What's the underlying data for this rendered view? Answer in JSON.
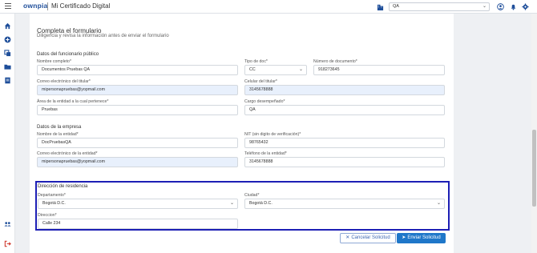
{
  "header": {
    "brand": "ownpia",
    "app_title": "Mi Certificado Digital",
    "company_value": "QA"
  },
  "form": {
    "title": "Completa el formulario",
    "subtitle": "Diligencia y revisa la información antes de enviar el formulario"
  },
  "funcionario": {
    "section_title": "Datos del funcionario público",
    "nombre_label": "Nombre completo*",
    "nombre_value": "Documentos Pruebas QA",
    "tipo_doc_label": "Tipo de doc*",
    "tipo_doc_value": "CC",
    "num_doc_label": "Número de documento*",
    "num_doc_value": "918273645",
    "correo_label": "Correo electrónico del titular*",
    "correo_value": "mipersonapruebas@yopmail.com",
    "celular_label": "Celular del titular*",
    "celular_value": "3145678888",
    "area_label": "Área de la entidad a la cual pertenece*",
    "area_value": "Pruebas",
    "cargo_label": "Cargo desempeñado*",
    "cargo_value": "QA"
  },
  "empresa": {
    "section_title": "Datos de la empresa",
    "nombre_label": "Nombre de la entidad*",
    "nombre_value": "DocPruebasQA",
    "nit_label": "NIT (sin digito de verificación)*",
    "nit_value": "98765432",
    "correo_label": "Correo electrónico de la entidad*",
    "correo_value": "mipersonapruebas@yopmail.com",
    "telefono_label": "Teléfono de la entidad*",
    "telefono_value": "3145678888"
  },
  "residencia": {
    "section_title": "Dirección de residencia",
    "departamento_label": "Departamento*",
    "departamento_value": "Bogotá D.C.",
    "ciudad_label": "Ciudad*",
    "ciudad_value": "Bogotá D.C.",
    "direccion_label": "Direccion*",
    "direccion_value": "Calle 234"
  },
  "actions": {
    "cancel_label": "Cancelar Solicitud",
    "send_label": "Enviar Solicitud"
  },
  "icons": {
    "menu": "hamburger-icon",
    "company": "building-icon",
    "user": "user-circle-icon",
    "bell": "bell-icon",
    "settings": "gear-icon",
    "home": "home-icon",
    "add": "plus-circle-icon",
    "copy": "copy-icon",
    "folder": "folder-icon",
    "document": "document-icon",
    "users": "users-icon",
    "logout": "logout-icon"
  },
  "colors": {
    "brand": "#1e4e9a",
    "highlight": "#1d1fb5",
    "primary_button": "#1f77c9",
    "autofill": "#e8f0fc"
  }
}
